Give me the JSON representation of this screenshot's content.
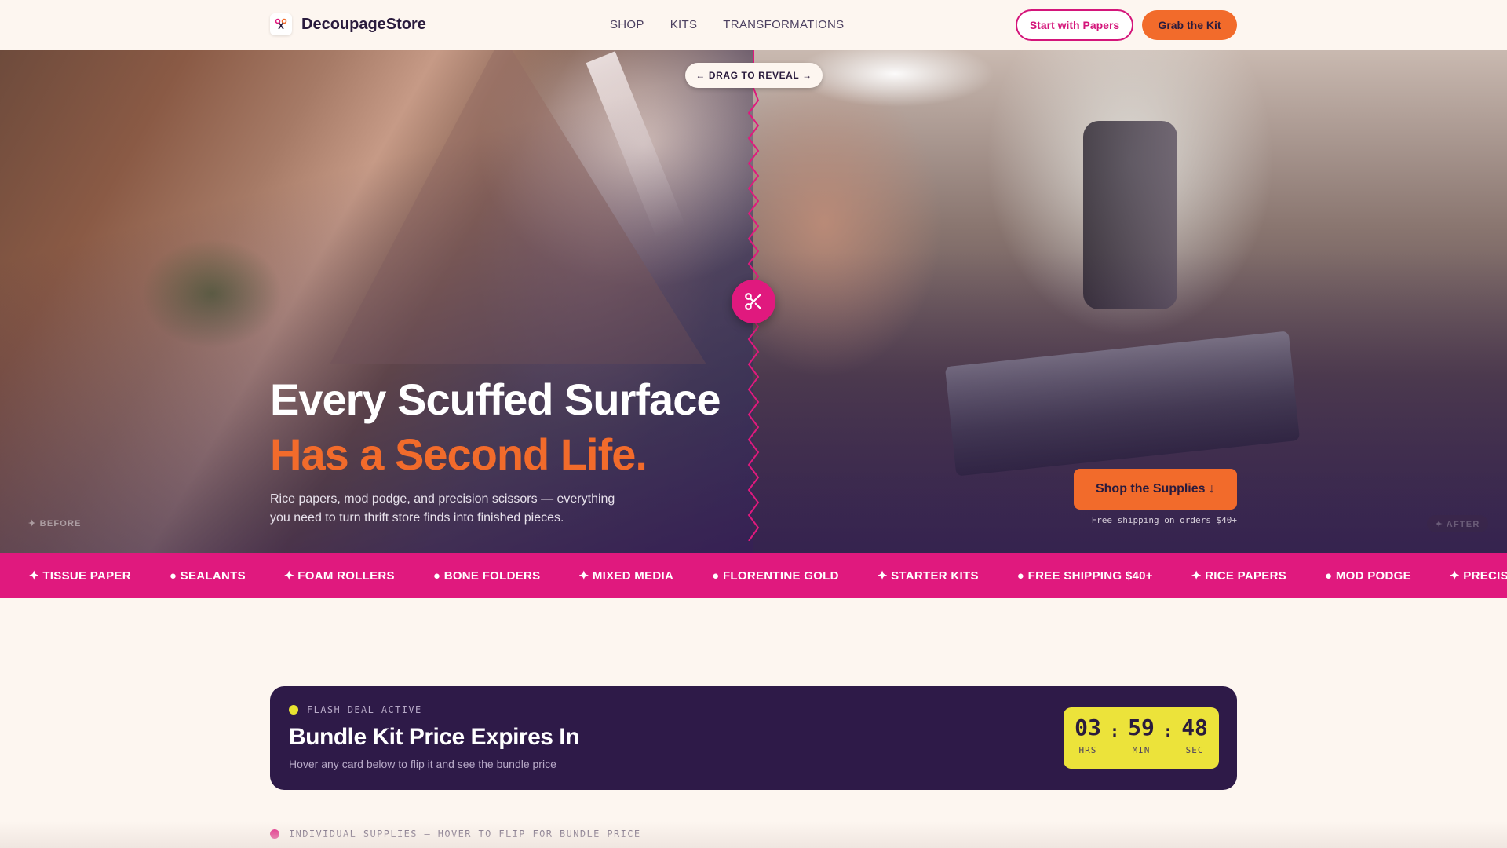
{
  "nav": {
    "brand": "DecoupageStore",
    "logo_icon": "scissors-logo-icon",
    "links": [
      "SHOP",
      "KITS",
      "TRANSFORMATIONS"
    ],
    "start_button": "Start with Papers",
    "kit_button": "Grab the Kit"
  },
  "hero": {
    "drag_hint": "← DRAG TO REVEAL →",
    "title_line1": "Every Scuffed Surface",
    "title_line2": "Has a Second Life.",
    "subtitle": "Rice papers, mod podge, and precision scissors — everything you need to turn thrift store finds into finished pieces.",
    "label_before": "✦ BEFORE",
    "label_after": "✦ AFTER",
    "cta": "Shop the Supplies ↓",
    "shipping_note": "Free shipping on orders $40+",
    "slider_position_percent": 50
  },
  "ticker": {
    "items": [
      "✦ TISSUE PAPER",
      "● SEALANTS",
      "✦ FOAM ROLLERS",
      "● BONE FOLDERS",
      "✦ MIXED MEDIA",
      "● FLORENTINE GOLD",
      "✦ STARTER KITS",
      "● FREE SHIPPING $40+",
      "✦ RICE PAPERS",
      "● MOD PODGE",
      "✦ PRECISION SCISSORS"
    ]
  },
  "deal": {
    "badge": "FLASH DEAL ACTIVE",
    "title": "Bundle Kit Price Expires In",
    "subtitle": "Hover any card below to flip it and see the bundle price",
    "timer": {
      "hours": "03",
      "minutes": "59",
      "seconds": "48",
      "hours_label": "HRS",
      "minutes_label": "MIN",
      "seconds_label": "SEC",
      "separator": ":"
    }
  },
  "section": {
    "label": "INDIVIDUAL SUPPLIES — HOVER TO FLIP FOR BUNDLE PRICE"
  },
  "colors": {
    "accent_pink": "#e0197e",
    "accent_orange": "#f26b2b",
    "deep_purple": "#2e1a48",
    "timer_yellow": "#ece33a",
    "background": "#fdf6f0"
  }
}
